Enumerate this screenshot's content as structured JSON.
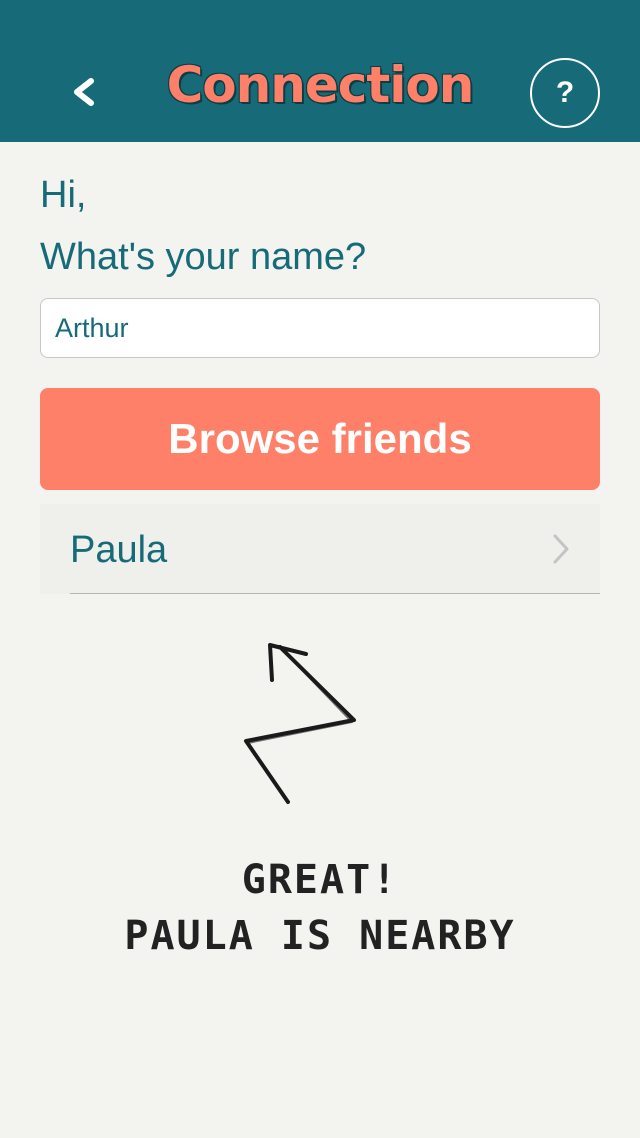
{
  "header": {
    "title": "Connection",
    "help_label": "?"
  },
  "form": {
    "greeting": "Hi,",
    "question": "What's your name?",
    "name_value": "Arthur",
    "browse_label": "Browse friends"
  },
  "friends": [
    {
      "name": "Paula"
    }
  ],
  "message": {
    "line1": "GREAT!",
    "line2": "PAULA IS NEARBY"
  },
  "colors": {
    "header_bg": "#176b78",
    "accent": "#ff8068",
    "text": "#176b78",
    "background": "#f3f3f0"
  },
  "icons": {
    "back": "back-arrow-icon",
    "help": "help-icon",
    "chevron": "chevron-right-icon",
    "arrow": "hand-drawn-zigzag-arrow"
  }
}
